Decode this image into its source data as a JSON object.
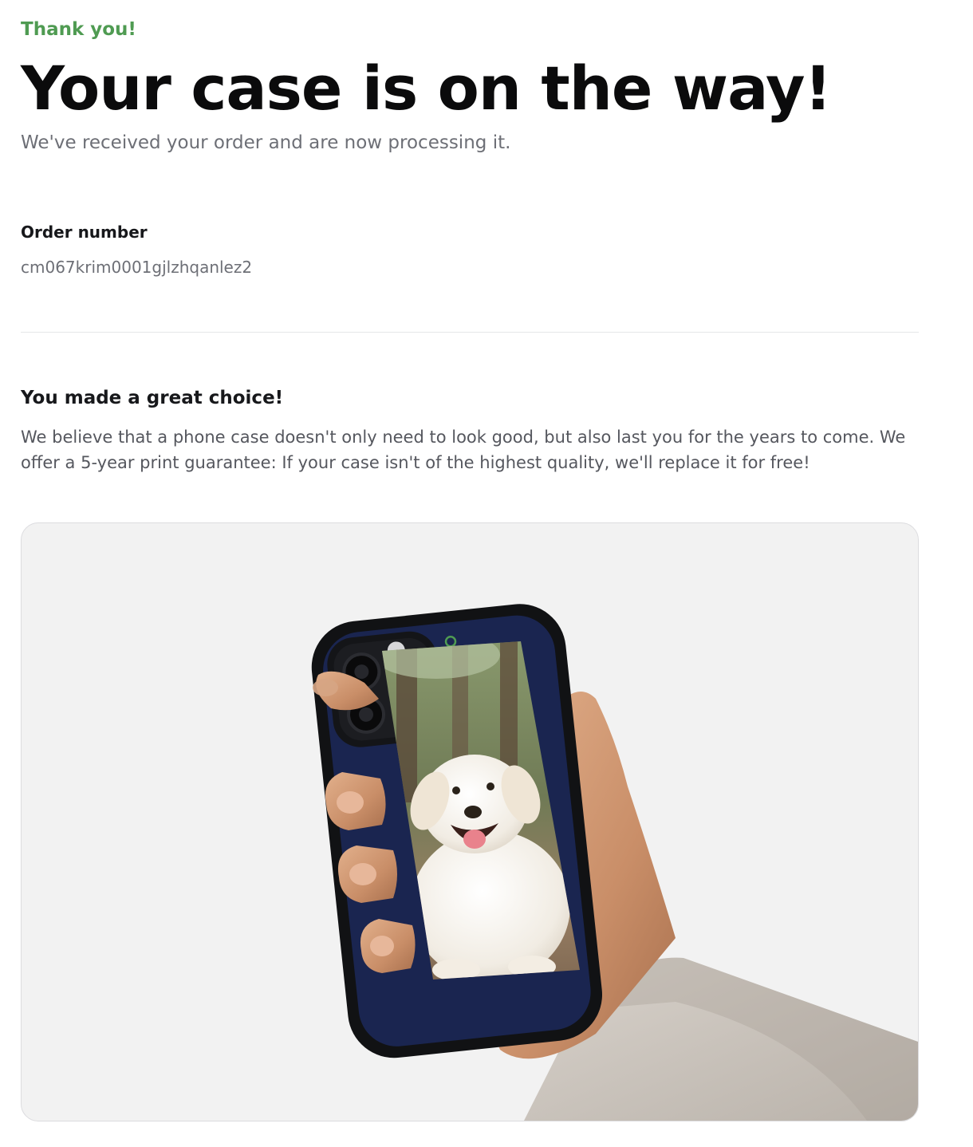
{
  "confirmation": {
    "eyebrow": "Thank you!",
    "headline": "Your case is on the way!",
    "subheadline": "We've received your order and are now processing it."
  },
  "order": {
    "label": "Order number",
    "number": "cm067krim0001gjlzhqanlez2"
  },
  "guarantee": {
    "title": "You made a great choice!",
    "body": "We believe that a phone case doesn't only need to look good, but also last you for the years to come. We offer a 5-year print guarantee: If your case isn't of the highest quality, we'll replace it for free!"
  },
  "preview": {
    "subject": "hand holding phone case with golden retriever photo",
    "case_color": "#1a2550",
    "background_color": "#f2f2f2",
    "accent_color": "#4f9b52"
  }
}
